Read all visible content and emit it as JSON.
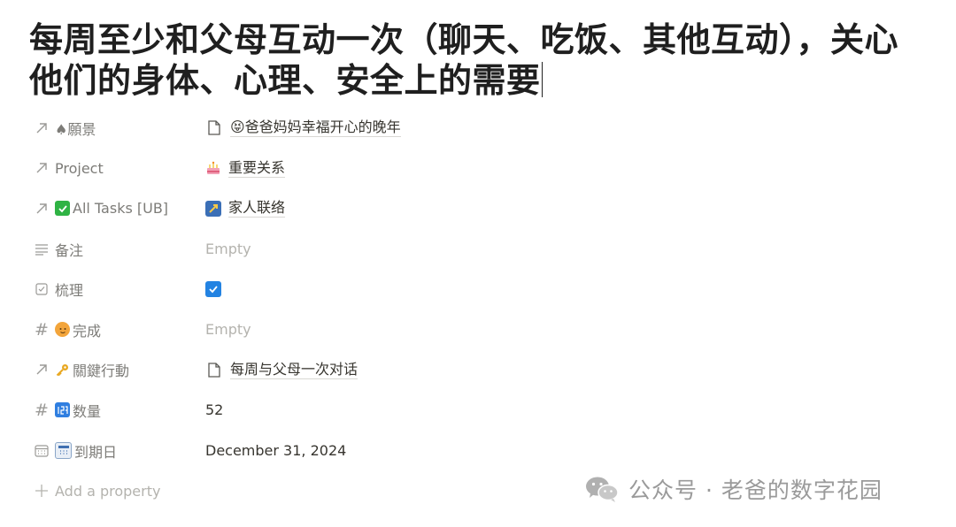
{
  "page": {
    "title": "每周至少和父母互动一次（聊天、吃饭、其他互动），关心他们的身体、心理、安全上的需要"
  },
  "properties": [
    {
      "key": "vision",
      "name": "♠願景",
      "icon": "relation-arrow-icon",
      "type": "relation",
      "value": "😝爸爸妈妈幸福开心的晚年",
      "value_icon": "page-icon"
    },
    {
      "key": "project",
      "name": "Project",
      "icon": "relation-arrow-icon",
      "type": "relation",
      "value": "重要关系",
      "value_icon": "cake-icon"
    },
    {
      "key": "all_tasks",
      "name": "All Tasks [UB]",
      "icon": "relation-arrow-icon",
      "name_icon": "check-mark-button-icon",
      "type": "relation",
      "value": "家人联络",
      "value_icon": "rocket-icon"
    },
    {
      "key": "notes",
      "name": "备注",
      "icon": "text-lines-icon",
      "type": "text",
      "value": "Empty"
    },
    {
      "key": "sorted",
      "name": "梳理",
      "icon": "checkbox-icon",
      "type": "checkbox",
      "value": "checked"
    },
    {
      "key": "done",
      "name": "完成",
      "icon": "hash-icon",
      "name_icon": "cat-face-icon",
      "type": "number",
      "value": "Empty"
    },
    {
      "key": "key_action",
      "name": "關鍵行動",
      "icon": "relation-arrow-icon",
      "name_icon": "key-icon",
      "type": "relation",
      "value": "每周与父母一次对话",
      "value_icon": "page-icon"
    },
    {
      "key": "count",
      "name": "数量",
      "icon": "hash-icon",
      "name_icon": "numbers-icon",
      "type": "number",
      "value": "52"
    },
    {
      "key": "due",
      "name": "到期日",
      "icon": "calendar-icon",
      "name_icon": "calendar-emoji-icon",
      "type": "date",
      "value": "December 31, 2024"
    }
  ],
  "add_property": {
    "label": "Add a property"
  },
  "watermark": {
    "text": "公众号 · 老爸的数字花园"
  },
  "colors": {
    "checkbox_blue": "#2383e2",
    "muted_text": "#7d7c78",
    "empty_text": "#b4b3ae"
  }
}
